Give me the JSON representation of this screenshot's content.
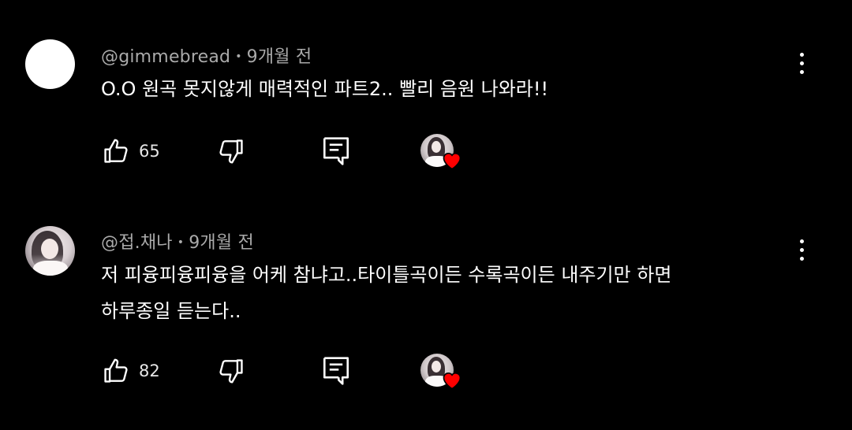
{
  "comments": [
    {
      "author": "@gimmebread",
      "separator": "•",
      "time": "9개월 전",
      "lines": [
        "O.O 원곡 못지않게 매력적인 파트2.. 빨리 음원 나와라!!"
      ],
      "likes": "65",
      "avatar": "plain-white"
    },
    {
      "author": "@접.채나",
      "separator": "•",
      "time": "9개월 전",
      "lines": [
        "저 피융피융피융을 어케 참냐고..타이틀곡이든 수록곡이든 내주기만 하면",
        "하루종일 듣는다.."
      ],
      "likes": "82",
      "avatar": "photo"
    }
  ],
  "icons": {
    "like": "thumbs-up-icon",
    "dislike": "thumbs-down-icon",
    "reply": "reply-icon",
    "menu": "more-vert-icon",
    "heart": "creator-heart-icon"
  },
  "colors": {
    "background": "#000000",
    "meta_text": "#aaaaaa",
    "heart": "#ff0000"
  }
}
